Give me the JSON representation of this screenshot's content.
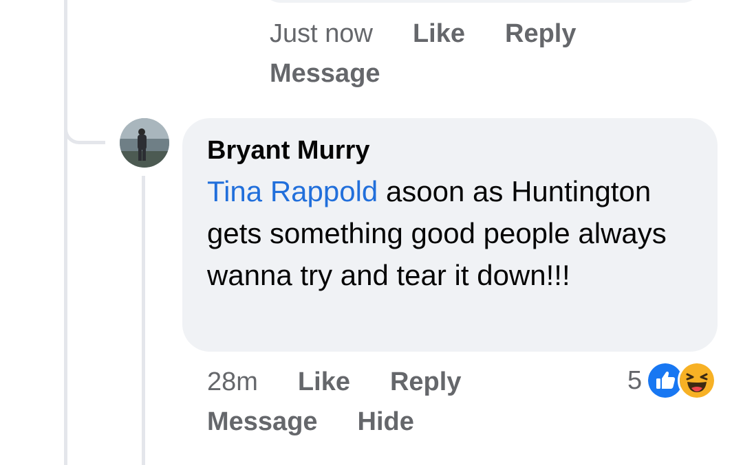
{
  "previous_comment": {
    "actions": {
      "timestamp": "Just now",
      "like_label": "Like",
      "reply_label": "Reply",
      "message_label": "Message"
    }
  },
  "comment": {
    "author": "Bryant Murry",
    "mention": "Tina Rappold",
    "text": " asoon as Huntington gets something good people always wanna try and tear it down!!!",
    "actions": {
      "timestamp": "28m",
      "like_label": "Like",
      "reply_label": "Reply",
      "message_label": "Message",
      "hide_label": "Hide"
    },
    "reactions": {
      "count": "5",
      "icons": [
        "like-icon",
        "haha-icon"
      ]
    }
  },
  "colors": {
    "bubble_bg": "#f0f2f5",
    "action_text": "#65676b",
    "mention": "#216fdb",
    "like_blue": "#1877f2",
    "haha_yellow": "#f7b125"
  }
}
